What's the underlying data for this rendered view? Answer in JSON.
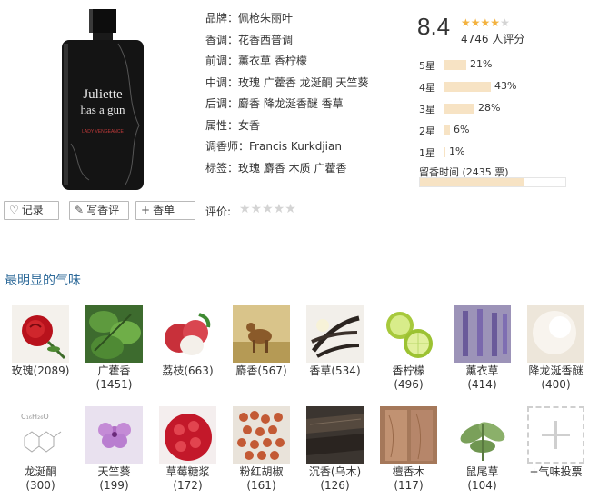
{
  "perfume": {
    "info": [
      {
        "key": "品牌：",
        "value": "佩枪朱丽叶"
      },
      {
        "key": "香调：",
        "value": "花香西普调"
      },
      {
        "key": "前调：",
        "value": "薰衣草 香柠檬"
      },
      {
        "key": "中调：",
        "value": "玫瑰 广藿香 龙涎酮 天竺葵"
      },
      {
        "key": "后调：",
        "value": "麝香 降龙涎香醚 香草"
      },
      {
        "key": "属性：",
        "value": "女香"
      },
      {
        "key": "调香师：",
        "value": "Francis Kurkdjian"
      },
      {
        "key": "标签：",
        "value": "玫瑰 麝香 木质 广藿香"
      }
    ],
    "bottle_label": {
      "line1": "Juliette",
      "line2": "has a gun",
      "sub": "LADY VENGEANCE"
    }
  },
  "rating": {
    "score": "8.4",
    "stars_filled": 4,
    "stars_total": 5,
    "votes": "4746 人评分",
    "distribution": [
      {
        "label": "5星",
        "percent_text": "21%",
        "percent": 21
      },
      {
        "label": "4星",
        "percent_text": "43%",
        "percent": 43
      },
      {
        "label": "3星",
        "percent_text": "28%",
        "percent": 28
      },
      {
        "label": "2星",
        "percent_text": "6%",
        "percent": 6
      },
      {
        "label": "1星",
        "percent_text": "1%",
        "percent": 1
      }
    ],
    "longevity_label": "留香时间 (2435 票)",
    "longevity_fill_percent": 72
  },
  "actions": {
    "record": "记录",
    "write_review": "写香评",
    "add_to_list": "香单",
    "rate_label": "评价:"
  },
  "notes_section": {
    "title": "最明显的气味",
    "items": [
      {
        "name": "玫瑰(2089)",
        "count": "",
        "icon": "rose"
      },
      {
        "name": "广藿香",
        "count": "(1451)",
        "icon": "patchouli"
      },
      {
        "name": "荔枝(663)",
        "count": "",
        "icon": "lychee"
      },
      {
        "name": "麝香(567)",
        "count": "",
        "icon": "deer"
      },
      {
        "name": "香草(534)",
        "count": "",
        "icon": "vanilla"
      },
      {
        "name": "香柠檬",
        "count": "(496)",
        "icon": "bergamot"
      },
      {
        "name": "薰衣草",
        "count": "(414)",
        "icon": "lavender"
      },
      {
        "name": "降龙涎香醚",
        "count": "(400)",
        "icon": "ambroxan"
      },
      {
        "name": "龙涎酮",
        "count": "(300)",
        "icon": "molecule"
      },
      {
        "name": "天竺葵",
        "count": "(199)",
        "icon": "geranium"
      },
      {
        "name": "草莓糖浆",
        "count": "(172)",
        "icon": "strawberry-syrup"
      },
      {
        "name": "粉红胡椒",
        "count": "(161)",
        "icon": "pink-pepper"
      },
      {
        "name": "沉香(乌木)",
        "count": "(126)",
        "icon": "oud"
      },
      {
        "name": "檀香木",
        "count": "(117)",
        "icon": "sandalwood"
      },
      {
        "name": "鼠尾草",
        "count": "(104)",
        "icon": "sage"
      },
      {
        "name": "+气味投票",
        "count": "",
        "icon": "add"
      }
    ]
  },
  "colors": {
    "link": "#2f6b9a",
    "star": "#f3b23f",
    "bar": "#f7e3c4"
  }
}
